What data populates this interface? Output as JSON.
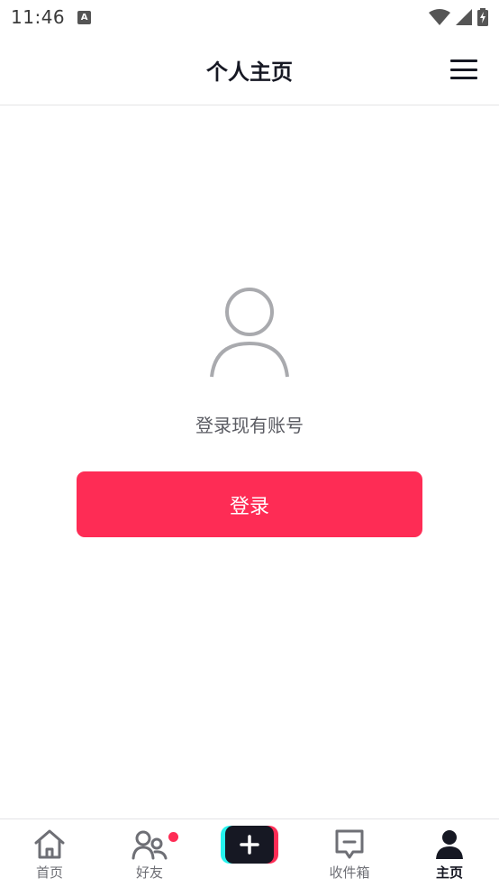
{
  "status_bar": {
    "time": "11:46",
    "app_icon_letter": "A",
    "icons": [
      "wifi-icon",
      "signal-icon",
      "battery-charging-icon"
    ]
  },
  "header": {
    "title": "个人主页",
    "menu_icon": "hamburger-menu-icon"
  },
  "main": {
    "avatar_icon": "user-placeholder-icon",
    "login_prompt": "登录现有账号",
    "login_button_label": "登录"
  },
  "tab_bar": {
    "tabs": [
      {
        "label": "首页",
        "icon": "home-icon",
        "active": false
      },
      {
        "label": "好友",
        "icon": "friends-icon",
        "active": false,
        "badge": true
      },
      {
        "label": "",
        "icon": "plus-icon",
        "active": false
      },
      {
        "label": "收件箱",
        "icon": "inbox-icon",
        "active": false
      },
      {
        "label": "主页",
        "icon": "profile-icon",
        "active": true
      }
    ]
  },
  "colors": {
    "accent": "#fe2c55",
    "text_primary": "#161823",
    "text_secondary": "#5a5b62",
    "cyan": "#25f4ee",
    "divider": "#e4e4e6"
  }
}
